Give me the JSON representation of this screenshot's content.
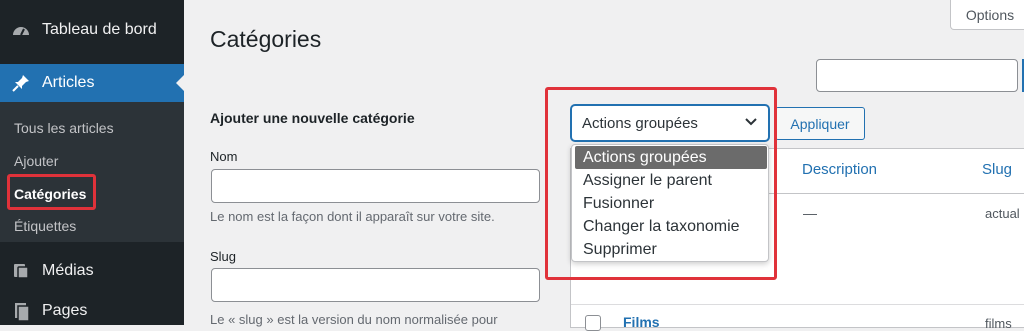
{
  "sidebar": {
    "items": [
      {
        "label": "Tableau de bord",
        "icon": "dashboard-icon"
      },
      {
        "label": "Articles",
        "icon": "pin-icon"
      },
      {
        "label": "Médias",
        "icon": "media-icon"
      },
      {
        "label": "Pages",
        "icon": "pages-icon"
      }
    ],
    "submenu": [
      "Tous les articles",
      "Ajouter",
      "Catégories",
      "Étiquettes"
    ]
  },
  "header": {
    "title": "Catégories",
    "options_label": "Options"
  },
  "form": {
    "heading": "Ajouter une nouvelle catégorie",
    "name_label": "Nom",
    "name_help": "Le nom est la façon dont il apparaît sur votre site.",
    "slug_label": "Slug",
    "slug_help": "Le « slug » est la version du nom normalisée pour"
  },
  "bulk": {
    "selected": "Actions groupées",
    "apply_label": "Appliquer",
    "options": [
      "Actions groupées",
      "Assigner le parent",
      "Fusionner",
      "Changer la taxonomie",
      "Supprimer"
    ]
  },
  "table": {
    "columns": [
      "Description",
      "Slug"
    ],
    "rows": [
      {
        "description": "—",
        "slug": "actual"
      },
      {
        "name": "Films",
        "slug": "films"
      }
    ]
  },
  "colors": {
    "accent": "#2271b1",
    "highlight": "#e0323a",
    "sidebar": "#1d2327"
  }
}
